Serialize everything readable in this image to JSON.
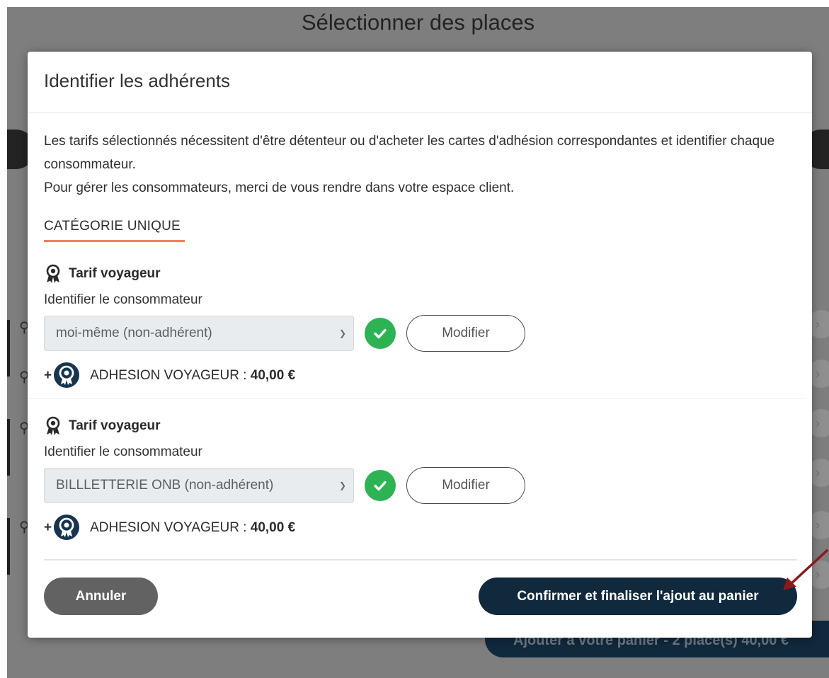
{
  "background": {
    "title": "Sélectionner des places",
    "cart_button": "Ajouter à votre panier - 2 place(s) 40,00 €"
  },
  "modal": {
    "title": "Identifier les adhérents",
    "intro_line1": "Les tarifs sélectionnés nécessitent d'être détenteur ou d'acheter les cartes d'adhésion correspondantes et identifier chaque consommateur.",
    "intro_line2": "Pour gérer les consommateurs, merci de vous rendre dans votre espace client.",
    "category_tab": "CATÉGORIE UNIQUE",
    "entries": [
      {
        "tarif": "Tarif voyageur",
        "identify_label": "Identifier le consommateur",
        "selected_consumer": "moi-même (non-adhérent)",
        "modify_label": "Modifier",
        "adhesion_plus": "+",
        "adhesion_label": "ADHESION VOYAGEUR : ",
        "adhesion_price": "40,00 €"
      },
      {
        "tarif": "Tarif voyageur",
        "identify_label": "Identifier le consommateur",
        "selected_consumer": "BILLLETTERIE ONB (non-adhérent)",
        "modify_label": "Modifier",
        "adhesion_plus": "+",
        "adhesion_label": "ADHESION VOYAGEUR : ",
        "adhesion_price": "40,00 €"
      }
    ],
    "cancel_label": "Annuler",
    "confirm_label": "Confirmer et finaliser l'ajout au panier"
  },
  "colors": {
    "primary_dark": "#10293d",
    "success": "#2db353",
    "accent_underline": "#f0815c",
    "arrow": "#8b1a1a"
  }
}
